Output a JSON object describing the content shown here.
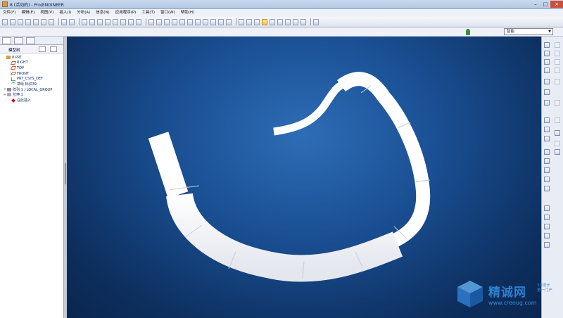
{
  "window": {
    "title": "8 (活动的) - Pro/ENGINEER",
    "controls": {
      "minimize": "–",
      "maximize": "□",
      "close": "×"
    }
  },
  "menubar": {
    "items": [
      "文件(F)",
      "编辑(E)",
      "视图(V)",
      "插入(I)",
      "分析(A)",
      "信息(N)",
      "应用程序(P)",
      "工具(T)",
      "窗口(W)",
      "帮助(H)"
    ]
  },
  "filter": {
    "value": "智能"
  },
  "nav": {
    "tree_label": "模型树",
    "tree": [
      {
        "label": "8.PRT",
        "icon": "part-icon",
        "expander": ""
      },
      {
        "label": "RIGHT",
        "icon": "datum-plane-icon",
        "expander": ""
      },
      {
        "label": "TOP",
        "icon": "datum-plane-icon",
        "expander": ""
      },
      {
        "label": "FRONT",
        "icon": "datum-plane-icon",
        "expander": ""
      },
      {
        "label": "PRT_CSYS_DEF",
        "icon": "csys-icon",
        "expander": ""
      },
      {
        "label": "草绘 标识39",
        "icon": "sketch-icon",
        "expander": ""
      },
      {
        "label": "阵列 1 / LOCAL_GROUP",
        "icon": "pattern-icon",
        "expander": "+"
      },
      {
        "label": "拉伸 1",
        "icon": "extrude-icon",
        "expander": "+"
      },
      {
        "label": "在此插入",
        "icon": "insert-here-icon",
        "expander": ""
      }
    ]
  },
  "watermark": {
    "brand": "精诚网",
    "side_line1": "3D设计",
    "side_line2": "第一门户",
    "url": "www.creoug.com"
  },
  "colors": {
    "viewport_top": "#2e6db6",
    "viewport_bottom": "#0a264e",
    "model": "#ffffff",
    "watermark": "#2d7fd0"
  }
}
